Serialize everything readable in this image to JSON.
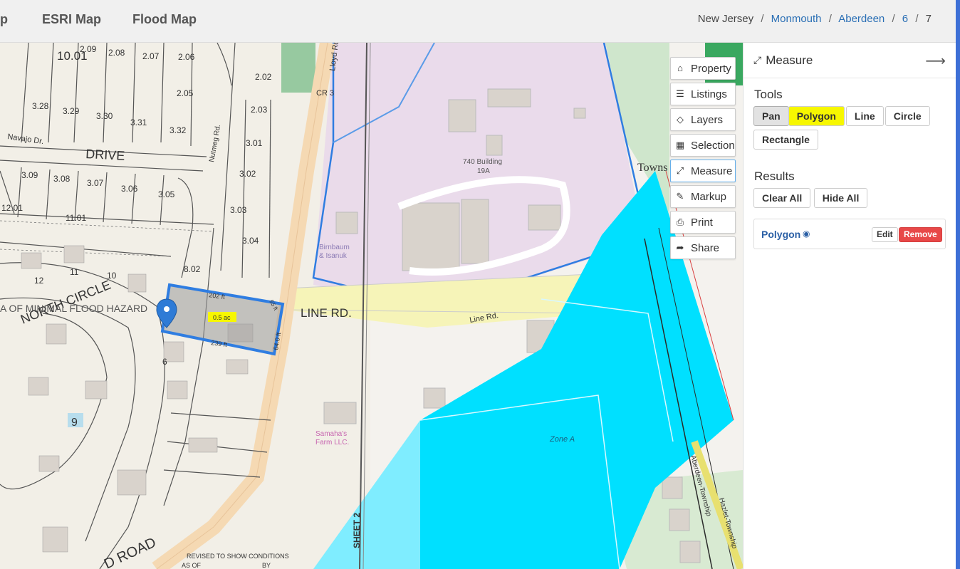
{
  "topbar": {
    "tabs": [
      "p",
      "ESRI Map",
      "Flood Map"
    ],
    "breadcrumb": {
      "state": "New Jersey",
      "county": "Monmouth",
      "town": "Aberdeen",
      "block": "6",
      "lot": "7"
    }
  },
  "map": {
    "labels": {
      "line_rd": "LINE  RD.",
      "line_rd_small": "Line Rd.",
      "lloyd_rd": "Lloyd Rd.",
      "cr3": "CR 3",
      "drive": "DRIVE",
      "navajo": "Navajo Dr.",
      "nutmeg": "Nutmeg Rd.",
      "north_circle": "NORTH  CIRCLE",
      "minimal_flood": "A OF MINIMAL FLOOD HAZARD",
      "building": "740 Building",
      "building_sub": "19A",
      "birnbaum": "Birnbaum",
      "birnbaum2": "& Isanuk",
      "samaha": "Samaha's",
      "samaha2": "Farm LLC.",
      "zone_a": "Zone A",
      "sheet2": "SHEET 2",
      "revised": "REVISED  TO  SHOW  CONDITIONS",
      "as_of": "AS OF",
      "by": "BY",
      "township": "Towns",
      "aberdeen_twp": "Aberdeen-Township",
      "hazlet_twp": "Hazlet-Township",
      "road": "D  ROAD",
      "area_label": "0.5 ac",
      "dim_top": "202 ft",
      "dim_bottom": "239 ft",
      "dim_right": "64.0 ft",
      "dim_corner": "55 ft",
      "lots": [
        "2.09",
        "2.08",
        "2.07",
        "2.06",
        "3.28",
        "3.29",
        "3.30",
        "3.31",
        "3.32",
        "2.05",
        "2.02",
        "2.03",
        "3.01",
        "3.02",
        "3.03",
        "3.04",
        "3.09",
        "3.08",
        "3.07",
        "3.06",
        "3.05",
        "12.01",
        "11.01",
        "10.01",
        "8.02",
        "10",
        "11",
        "12",
        "6",
        "9"
      ]
    },
    "buttons": [
      {
        "label": "Property",
        "icon": "home-icon"
      },
      {
        "label": "Listings",
        "icon": "list-icon"
      },
      {
        "label": "Layers",
        "icon": "layers-icon"
      },
      {
        "label": "Selection",
        "icon": "grid-icon"
      },
      {
        "label": "Measure",
        "icon": "measure-icon"
      },
      {
        "label": "Markup",
        "icon": "brush-icon"
      },
      {
        "label": "Print",
        "icon": "print-icon"
      },
      {
        "label": "Share",
        "icon": "share-icon"
      }
    ]
  },
  "panel": {
    "title": "Measure",
    "tools_label": "Tools",
    "tools": [
      "Pan",
      "Polygon",
      "Line",
      "Circle",
      "Rectangle"
    ],
    "results_label": "Results",
    "clear_all": "Clear All",
    "hide_all": "Hide All",
    "result_item": {
      "name": "Polygon",
      "edit": "Edit",
      "remove": "Remove"
    }
  },
  "colors": {
    "accent": "#2a6fb5",
    "flood_zone": "#00e0ff",
    "highlight": "#f7f700",
    "remove": "#e84848",
    "parcel_outline": "#2f7de1"
  }
}
